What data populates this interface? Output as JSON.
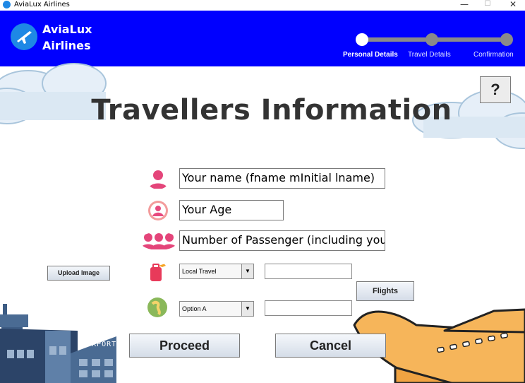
{
  "window": {
    "title": "AviaLux Airlines",
    "minimize": "—",
    "maximize": "☐",
    "close": "✕"
  },
  "brand": {
    "line1": "AviaLux",
    "line2": "Airlines"
  },
  "steps": [
    {
      "label": "Personal Details"
    },
    {
      "label": "Travel Details"
    },
    {
      "label": "Confirmation"
    }
  ],
  "help_label": "?",
  "page_title": "Travellers Information",
  "form": {
    "name_field": "Your name (fname mInitial lname)",
    "age_field": "Your Age",
    "passengers_field": "Number of Passenger (including you)",
    "travel_type": "Local Travel",
    "travel_text": "",
    "option": "Option A",
    "option_text": ""
  },
  "buttons": {
    "upload": "Upload Image",
    "flights": "Flights",
    "proceed": "Proceed",
    "cancel": "Cancel"
  },
  "scene": {
    "airport_sign": "AIRPORT"
  },
  "colors": {
    "header_bg": "#0000ff",
    "active_dot": "#ffffff",
    "inactive_dot": "#8a8a8a",
    "plane": "#f6b55a"
  }
}
